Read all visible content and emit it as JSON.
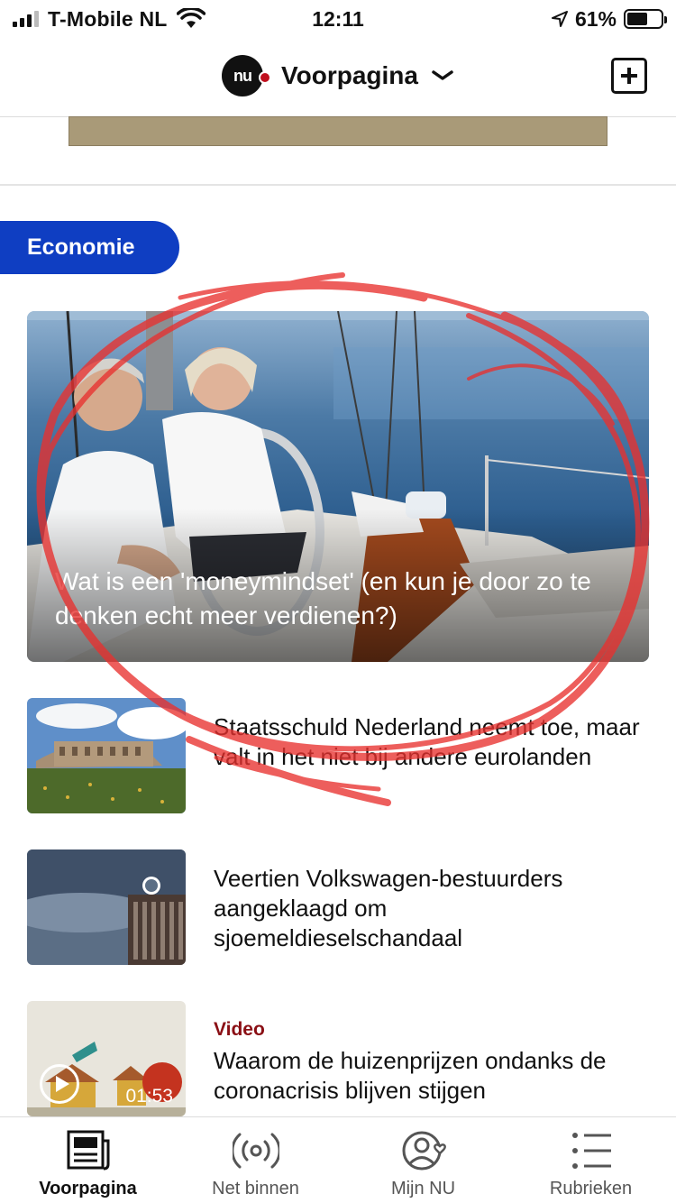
{
  "status_bar": {
    "carrier": "T-Mobile NL",
    "time": "12:11",
    "battery_percent": "61%",
    "battery_level": 0.61
  },
  "header": {
    "logo_text": "nu",
    "title": "Voorpagina",
    "icons": {
      "dropdown": "chevron-down-icon",
      "add": "add-square-icon"
    }
  },
  "section": {
    "label": "Economie"
  },
  "hero": {
    "title": "Wat is een 'moneymindset' (en kun je door zo te denken echt meer verdienen?)"
  },
  "articles": [
    {
      "title": "Staatsschuld Nederland neemt toe, maar valt in het niet bij andere eurolanden"
    },
    {
      "title": "Veertien Volkswagen-bestuurders aangeklaagd om sjoemeldieselschandaal"
    },
    {
      "tag": "Video",
      "duration": "01:53",
      "title": "Waarom de huizenprijzen ondanks de coronacrisis blijven stijgen"
    }
  ],
  "tab_bar": {
    "tabs": [
      {
        "label": "Voorpagina",
        "icon": "newspaper-icon",
        "active": true
      },
      {
        "label": "Net binnen",
        "icon": "broadcast-icon",
        "active": false
      },
      {
        "label": "Mijn NU",
        "icon": "profile-heart-icon",
        "active": false
      },
      {
        "label": "Rubrieken",
        "icon": "list-icon",
        "active": false
      }
    ]
  },
  "colors": {
    "section_blue": "#0f3ec2",
    "video_tag_red": "#8a0e14",
    "annotation_red": "#e8312f"
  }
}
